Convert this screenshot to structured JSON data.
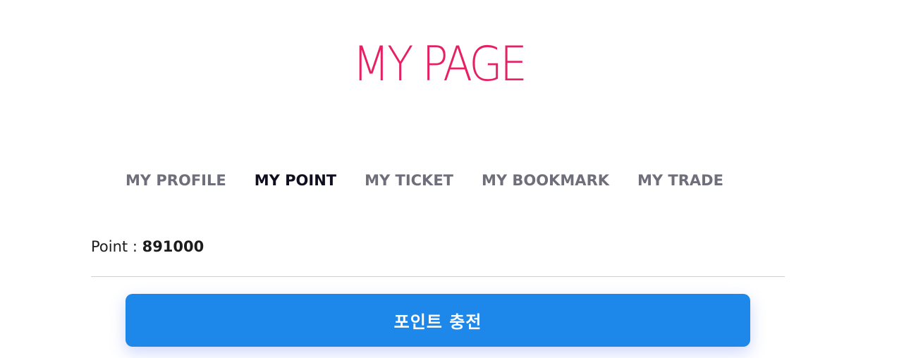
{
  "page": {
    "title": "MY PAGE"
  },
  "tabs": [
    {
      "label": "MY PROFILE",
      "active": false
    },
    {
      "label": "MY POINT",
      "active": true
    },
    {
      "label": "MY TICKET",
      "active": false
    },
    {
      "label": "MY BOOKMARK",
      "active": false
    },
    {
      "label": "MY TRADE",
      "active": false
    }
  ],
  "point": {
    "label": "Point : ",
    "value": "891000"
  },
  "charge": {
    "button_label": "포인트 충전"
  },
  "colors": {
    "title": "#e62163",
    "tab_inactive": "#6e6f7b",
    "tab_active": "#0f0f1f",
    "button_bg": "#1e87ea"
  }
}
